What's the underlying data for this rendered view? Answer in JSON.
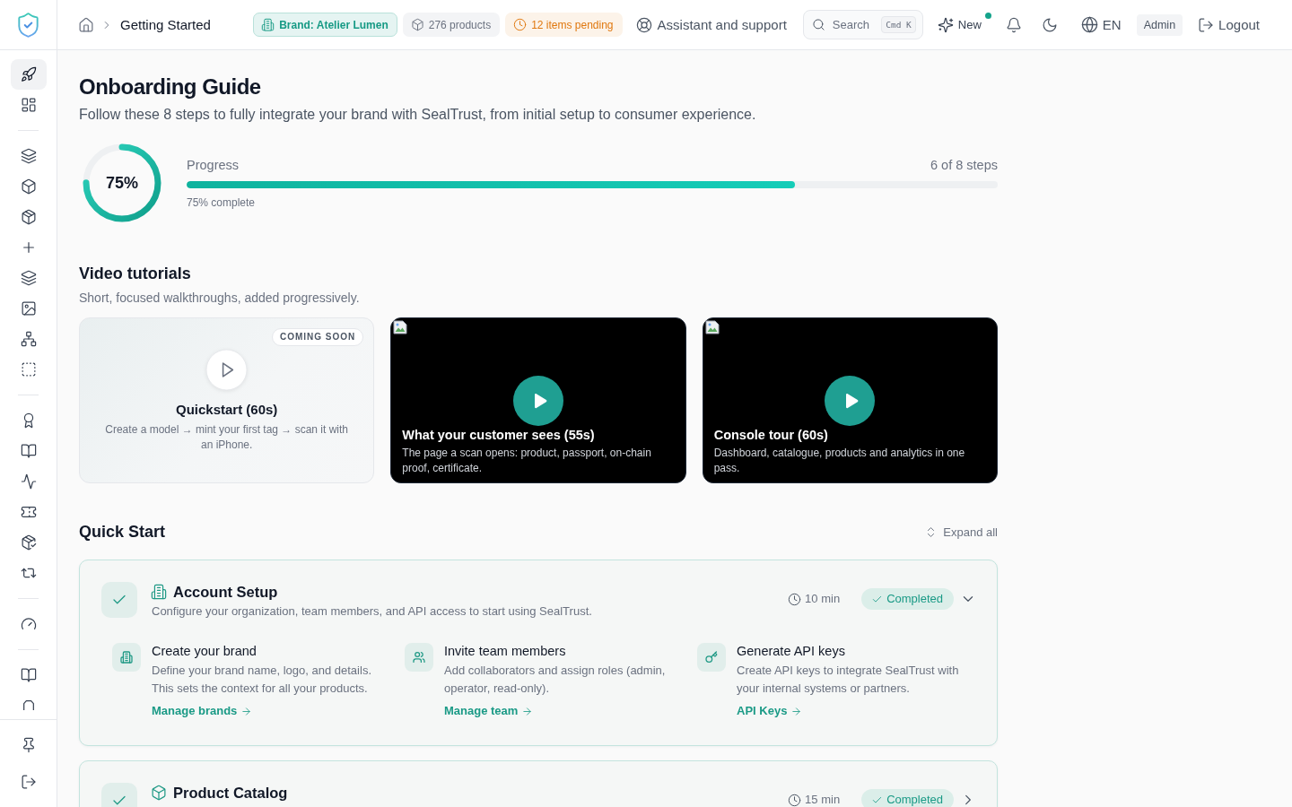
{
  "sidebar": {
    "groups": [
      {
        "items": [
          {
            "selected": true
          },
          {
            "selected": false
          }
        ]
      },
      {
        "items": [
          {
            "selected": false
          },
          {
            "selected": false
          },
          {
            "selected": false
          },
          {
            "selected": false
          },
          {
            "selected": false
          },
          {
            "selected": false
          },
          {
            "selected": false
          },
          {
            "selected": false
          }
        ]
      },
      {
        "items": [
          {
            "selected": false
          },
          {
            "selected": false
          },
          {
            "selected": false
          },
          {
            "selected": false
          },
          {
            "selected": false
          },
          {
            "selected": false
          }
        ]
      },
      {
        "items": [
          {
            "selected": false
          }
        ]
      },
      {
        "items": [
          {
            "selected": false
          },
          {
            "selected": false
          }
        ]
      }
    ]
  },
  "topbar": {
    "breadcrumb": {
      "current": "Getting Started"
    },
    "badges": [
      {
        "kind": "brand",
        "label": "Brand: Atelier Lumen",
        "color": "#179a85"
      },
      {
        "kind": "products",
        "label": "276 products",
        "color": "#6b7280"
      },
      {
        "kind": "pending",
        "label": "12 items pending",
        "color": "#e0780f"
      }
    ],
    "support_link": "Assistant and support",
    "search": {
      "placeholder": "Search",
      "shortcut": "Cmd K"
    },
    "new_button": {
      "label": "New",
      "unread": true
    },
    "language": "EN",
    "role": "Admin",
    "logout": "Logout"
  },
  "page": {
    "title": "Onboarding Guide",
    "subtitle": "Follow these 8 steps to fully integrate your brand with SealTrust, from initial setup to consumer experience."
  },
  "progress": {
    "percent": "75%",
    "label": "Progress",
    "steps": "6 of 8 steps",
    "level": 0.75,
    "caption": "75% complete"
  },
  "videos": {
    "title": "Video tutorials",
    "subtitle": "Short, focused walkthroughs, added progressively.",
    "items": [
      {
        "kind": "coming_soon",
        "badge": "COMING SOON",
        "title": "Quickstart (60s)",
        "description": "Create a model → mint your first tag → scan it with an iPhone."
      },
      {
        "kind": "video",
        "title": "What your customer sees (55s)",
        "description": "The page a scan opens: product, passport, on-chain proof, certificate."
      },
      {
        "kind": "video",
        "title": "Console tour (60s)",
        "description": "Dashboard, catalogue, products and analytics in one pass."
      }
    ]
  },
  "quick_start": {
    "title": "Quick Start",
    "expand_all": "Expand all",
    "steps": [
      {
        "title": "Account Setup",
        "description": "Configure your organization, team members, and API access to start using SealTrust.",
        "duration": "10 min",
        "status": "Completed",
        "completed": true,
        "expanded": true,
        "tasks": [
          {
            "title": "Create your brand",
            "description": "Define your brand name, logo, and details. This sets the context for all your products.",
            "link": "Manage brands"
          },
          {
            "title": "Invite team members",
            "description": "Add collaborators and assign roles (admin, operator, read-only).",
            "link": "Manage team"
          },
          {
            "title": "Generate API keys",
            "description": "Create API keys to integrate SealTrust with your internal systems or partners.",
            "link": "API Keys"
          }
        ]
      },
      {
        "title": "Product Catalog",
        "duration": "15 min",
        "status": "Completed",
        "completed": true,
        "expanded": false
      }
    ]
  }
}
